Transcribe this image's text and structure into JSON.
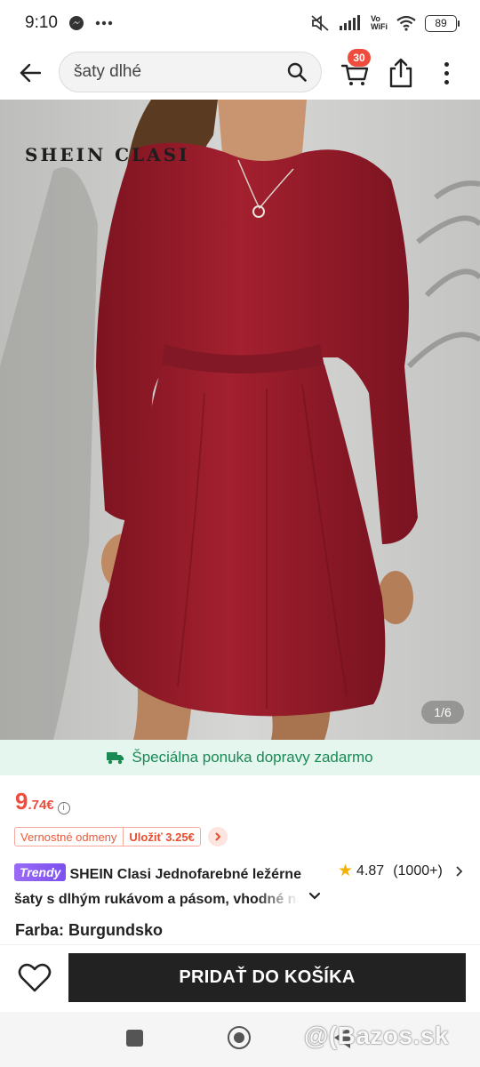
{
  "status_bar": {
    "time": "9:10",
    "battery": "89",
    "wifi_label_top": "Vo",
    "wifi_label_bottom": "WiFi"
  },
  "header": {
    "search_value": "šaty dlhé",
    "cart_count": "30"
  },
  "gallery": {
    "brand_watermark": "SHEIN CLASI",
    "counter": "1/6"
  },
  "shipping_banner": {
    "text": "Špeciálna ponuka dopravy zadarmo",
    "color": "#1a8a55"
  },
  "price": {
    "integer": "9",
    "decimal": ".74€",
    "color": "#ef4c3d"
  },
  "rewards": {
    "label": "Vernostné odmeny",
    "save": "Uložiť 3.25€"
  },
  "product": {
    "badge": "Trendy",
    "title_line1": "SHEIN Clasi Jednofarebné ležérne",
    "title_line2": "šaty s dlhým rukávom a pásom, vhodné na",
    "rating": "4.87",
    "review_count": "(1000+)"
  },
  "color_row": "Farba: Burgundsko",
  "actions": {
    "add_to_cart": "PRIDAŤ DO KOŠÍKA"
  },
  "watermark": "@(Bazos.sk",
  "colors": {
    "dress": "#9c1e2b",
    "accent": "#ef4c3d",
    "dark_button": "#222222"
  }
}
